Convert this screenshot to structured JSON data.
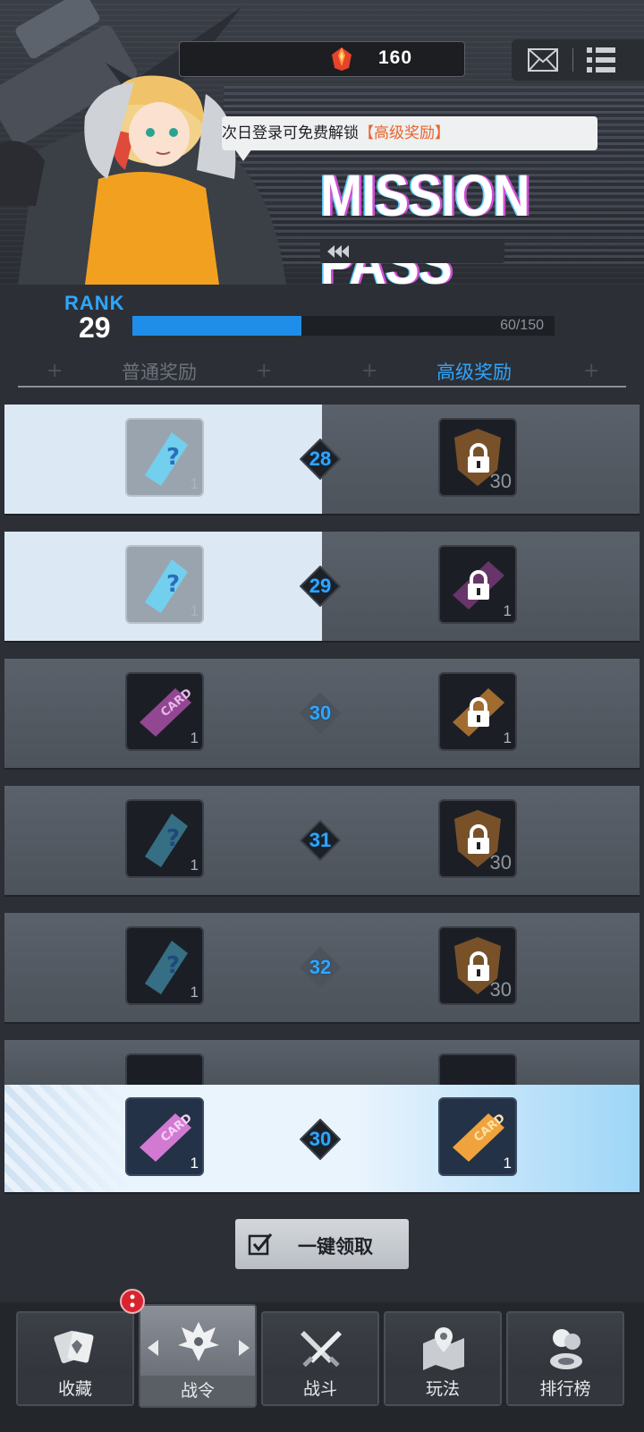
{
  "header": {
    "currency_value": "160",
    "tip_prefix": "次日登录可免费解锁",
    "tip_highlight": "【高级奖励】",
    "title": "MISSION PASS"
  },
  "rank": {
    "label": "RANK",
    "value": "29",
    "progress_text": "60/150",
    "progress_fraction": 0.4
  },
  "tabs": {
    "normal": "普通奖励",
    "premium": "高级奖励"
  },
  "rows": [
    {
      "level": "28",
      "free_qty": "1",
      "premium_qty": "30"
    },
    {
      "level": "29",
      "free_qty": "1",
      "premium_qty": "1"
    },
    {
      "level": "30",
      "free_qty": "1",
      "premium_qty": "1"
    },
    {
      "level": "31",
      "free_qty": "1",
      "premium_qty": "30"
    },
    {
      "level": "32",
      "free_qty": "1",
      "premium_qty": "30"
    }
  ],
  "sticky_row": {
    "level": "30",
    "free_qty": "1",
    "premium_qty": "1"
  },
  "claim_button": {
    "label": "一键领取"
  },
  "nav": {
    "items": [
      {
        "label": "收藏",
        "icon": "cards-icon"
      },
      {
        "label": "战令",
        "icon": "crest-icon"
      },
      {
        "label": "战斗",
        "icon": "crossed-swords-icon"
      },
      {
        "label": "玩法",
        "icon": "map-pin-icon"
      },
      {
        "label": "排行榜",
        "icon": "leaderboard-icon"
      }
    ],
    "active_index": 1
  },
  "colors": {
    "accent_blue": "#2ea6ff",
    "tip_highlight": "#e8642a",
    "badge_red": "#d8242f"
  }
}
